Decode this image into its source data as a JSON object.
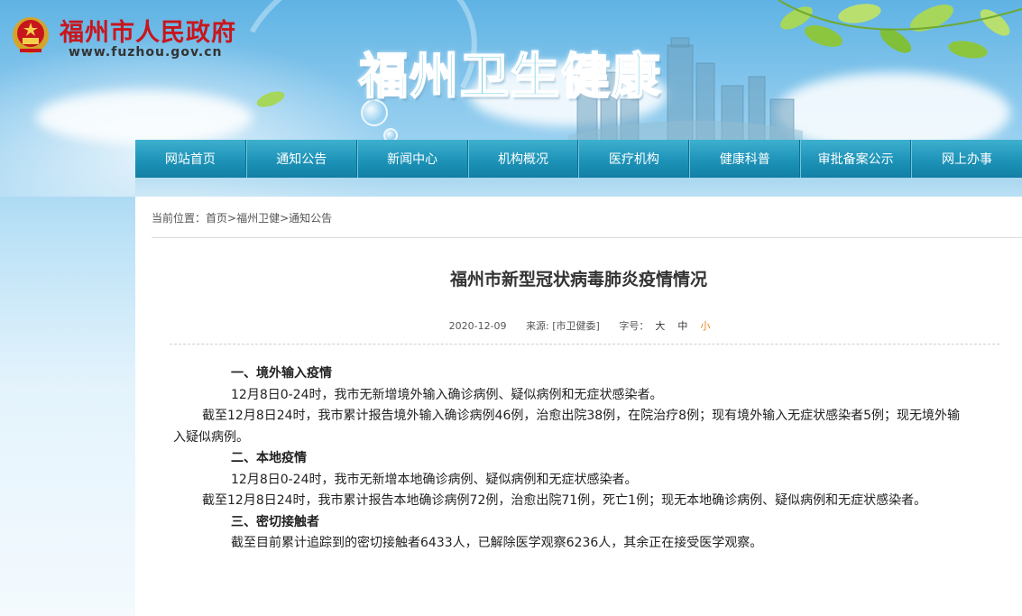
{
  "header": {
    "gov_name": "福州市人民政府",
    "gov_url": "www.fuzhou.gov.cn",
    "site_title": "福州卫生健康"
  },
  "nav": {
    "items": [
      "网站首页",
      "通知公告",
      "新闻中心",
      "机构概况",
      "医疗机构",
      "健康科普",
      "审批备案公示",
      "网上办事"
    ]
  },
  "breadcrumb": {
    "prefix": "当前位置：",
    "home": "首页",
    "sep1": ">",
    "section": "福州卫健",
    "sep2": ">",
    "current": "通知公告"
  },
  "article": {
    "title": "福州市新型冠状病毒肺炎疫情情况",
    "date": "2020-12-09",
    "source": "来源: [市卫健委]",
    "font_size_label": "字号：",
    "size_large": "大",
    "size_medium": "中",
    "size_small": "小",
    "paragraphs": [
      {
        "heading": true,
        "text": "一、境外输入疫情"
      },
      {
        "heading": false,
        "text": "12月8日0-24时，我市无新增境外输入确诊病例、疑似病例和无症状感染者。"
      },
      {
        "heading": false,
        "text": "截至12月8日24时，我市累计报告境外输入确诊病例46例，治愈出院38例，在院治疗8例；现有境外输入无症状感染者5例；现无境外输入疑似病例。"
      },
      {
        "heading": true,
        "text": "二、本地疫情"
      },
      {
        "heading": false,
        "text": "12月8日0-24时，我市无新增本地确诊病例、疑似病例和无症状感染者。"
      },
      {
        "heading": false,
        "text": "截至12月8日24时，我市累计报告本地确诊病例72例，治愈出院71例，死亡1例；现无本地确诊病例、疑似病例和无症状感染者。"
      },
      {
        "heading": true,
        "text": "三、密切接触者"
      },
      {
        "heading": false,
        "text": "截至目前累计追踪到的密切接触者6433人，已解除医学观察6236人，其余正在接受医学观察。"
      }
    ]
  },
  "colors": {
    "nav": "#1d93b8",
    "gov_red": "#c8161d",
    "title_cyan": "#23b3d6",
    "active_size": "#e8831c"
  }
}
